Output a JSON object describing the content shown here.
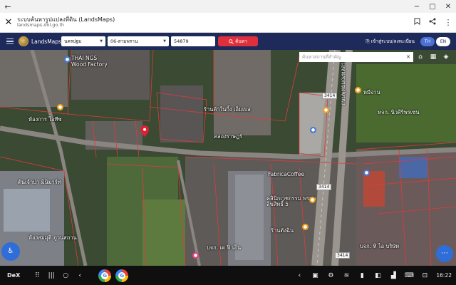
{
  "window": {
    "back": "←",
    "minimize": "−",
    "restore": "▢",
    "close": "✕"
  },
  "tab": {
    "close": "✕",
    "title": "ระบบค้นหารูปแปลงที่ดิน (LandsMaps)",
    "url": "landsmaps.dol.go.th",
    "bookmark_icon": "bookmark-icon",
    "share_icon": "share-icon",
    "menu_icon": "more-vert-icon"
  },
  "site": {
    "brand": "LandsMaps",
    "province": "นครปฐม",
    "district": "06-สามพราน",
    "parcel_number": "54879",
    "search_button": "ค้นหา",
    "login": "เข้าสู่ระบบ/ลงทะเบียน",
    "lang_th": "TH",
    "lang_en": "EN",
    "accent": "#1e2a5a",
    "search_color": "#e02f3c"
  },
  "map": {
    "search_placeholder": "ค้นหาสถานที่สำคัญ",
    "labels": {
      "thai_ngs": "THAI NGS",
      "wood_factory": "Wood Factory",
      "factory_a": "ห้องการ ไอทีซ",
      "mini_mart": "ต้นเจ้าป่า มินิมาร์ท",
      "moo_jan": "หมีจาน",
      "nivet": "หจก. นิวศิริพรเซ่น",
      "fabrica": "FabricaCoffee",
      "clinic": "คลินิกเวชกรรม พรหมลิขสิทธิ์ 5",
      "shop_pink": "ร้านตังฉิน",
      "company_a": "บจก. เด ฟิ เอ็น",
      "company_b": "บจก. ทิ ไอ บริษัท",
      "road_right": "ถนนพุทธมณฑลสาย 5",
      "road_left": "คลองราษฎร์",
      "route_3414_a": "3414",
      "route_3414_b": "3414",
      "route_3414_c": "3414",
      "shop_top": "ร้านค้าในกิ้ง เอ็มเบส",
      "shop_bottom": "ห้องสมมุติ ภูวนสถาน"
    }
  },
  "taskbar": {
    "dex": "DeX",
    "time": "16:22"
  }
}
